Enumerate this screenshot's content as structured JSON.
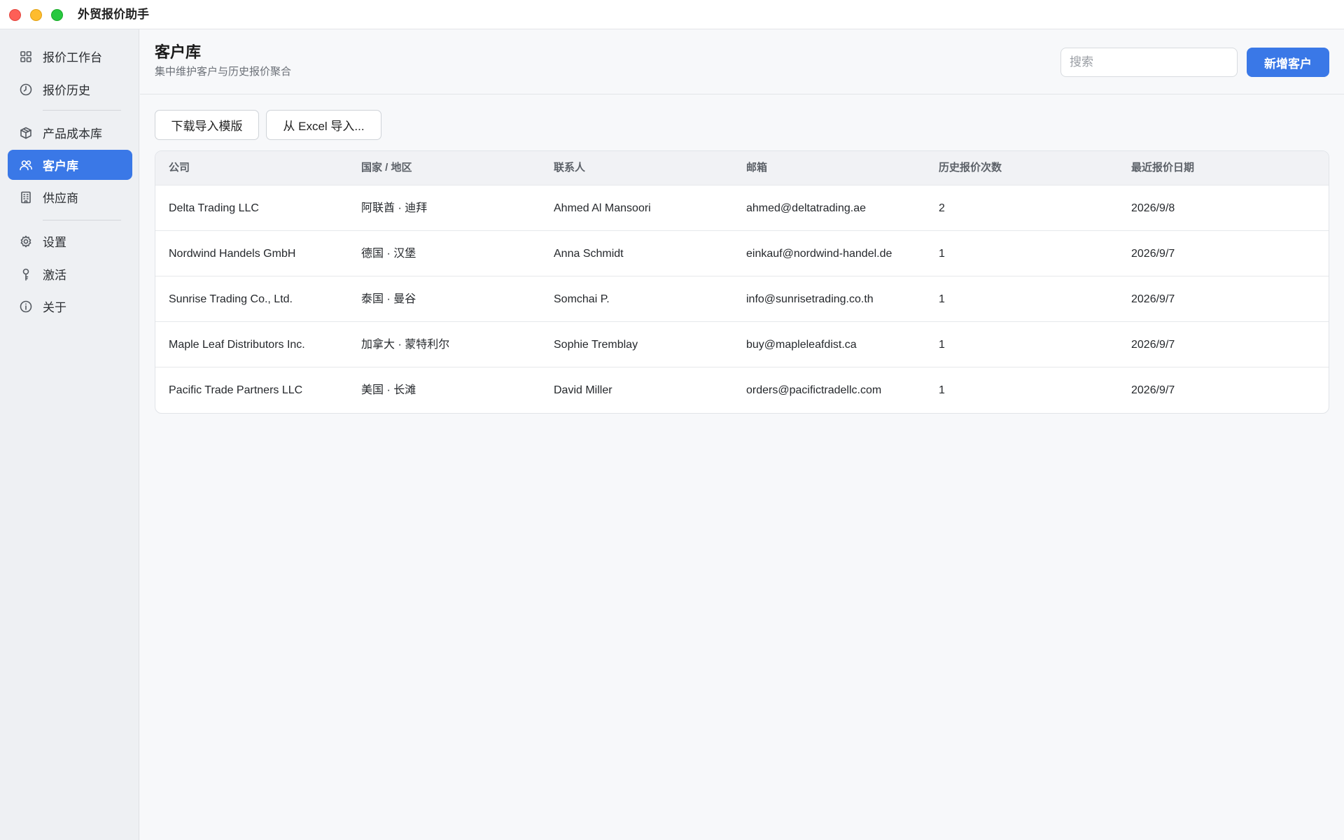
{
  "window": {
    "title": "外贸报价助手"
  },
  "sidebar": {
    "items": [
      {
        "label": "报价工作台",
        "icon": "grid-icon",
        "active": false
      },
      {
        "label": "报价历史",
        "icon": "clock-icon",
        "active": false
      },
      {
        "label": "产品成本库",
        "icon": "box-icon",
        "active": false
      },
      {
        "label": "客户库",
        "icon": "users-icon",
        "active": true
      },
      {
        "label": "供应商",
        "icon": "building-icon",
        "active": false
      },
      {
        "label": "设置",
        "icon": "gear-icon",
        "active": false
      },
      {
        "label": "激活",
        "icon": "key-icon",
        "active": false
      },
      {
        "label": "关于",
        "icon": "info-icon",
        "active": false
      }
    ]
  },
  "header": {
    "title": "客户库",
    "subtitle": "集中维护客户与历史报价聚合",
    "search_placeholder": "搜索",
    "add_label": "新增客户"
  },
  "toolbar": {
    "download_template_label": "下载导入模版",
    "import_excel_label": "从 Excel 导入..."
  },
  "table": {
    "columns": [
      "公司",
      "国家 / 地区",
      "联系人",
      "邮箱",
      "历史报价次数",
      "最近报价日期"
    ],
    "rows": [
      [
        "Delta Trading LLC",
        "阿联酋 · 迪拜",
        "Ahmed Al Mansoori",
        "ahmed@deltatrading.ae",
        "2",
        "2026/9/8"
      ],
      [
        "Nordwind Handels GmbH",
        "德国 · 汉堡",
        "Anna Schmidt",
        "einkauf@nordwind-handel.de",
        "1",
        "2026/9/7"
      ],
      [
        "Sunrise Trading Co., Ltd.",
        "泰国 · 曼谷",
        "Somchai P.",
        "info@sunrisetrading.co.th",
        "1",
        "2026/9/7"
      ],
      [
        "Maple Leaf Distributors Inc.",
        "加拿大 · 蒙特利尔",
        "Sophie Tremblay",
        "buy@mapleleafdist.ca",
        "1",
        "2026/9/7"
      ],
      [
        "Pacific Trade Partners LLC",
        "美国 · 长滩",
        "David Miller",
        "orders@pacifictradellc.com",
        "1",
        "2026/9/7"
      ]
    ]
  },
  "colors": {
    "accent": "#3a78e7",
    "sidebar_bg": "#eef0f3",
    "page_bg": "#f7f8fa"
  }
}
